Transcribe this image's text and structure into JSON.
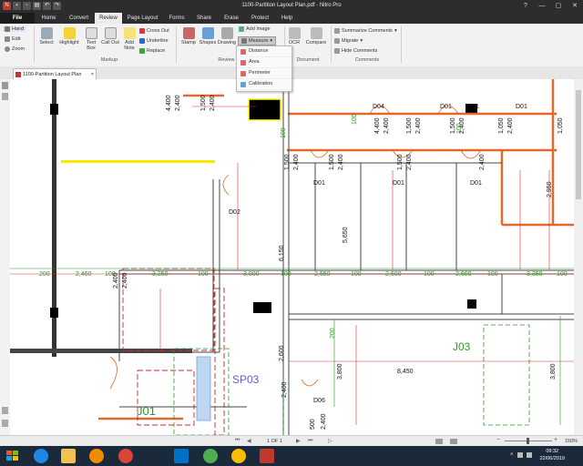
{
  "window": {
    "title": "1100-Partition Layout Plan.pdf - Nitro Pro"
  },
  "tabs": [
    "File",
    "Home",
    "Convert",
    "Review",
    "Page Layout",
    "Forms",
    "Share",
    "Erase",
    "Protect",
    "Help"
  ],
  "ribbon": {
    "hand": "Hand",
    "edit": "Edit",
    "zoom": "Zoom",
    "select": "Select",
    "highlight": "Highlight",
    "textbox": "Text Box",
    "callout": "Call Out",
    "addnote": "Add Note",
    "crossout": "Cross Out",
    "underline": "Underline",
    "replace": "Replace",
    "stamp": "Stamp",
    "shapes": "Shapes",
    "drawing": "Drawing",
    "addimage": "Add Image",
    "measure": "Measure",
    "ocr": "OCR",
    "compare": "Compare",
    "summarize": "Summarize Comments",
    "migrate": "Migrate",
    "hidecomments": "Hide Comments",
    "groups": {
      "markup": "Markup",
      "reviewtools": "Review To",
      "document": "Document",
      "comments": "Comments"
    }
  },
  "measure_menu": [
    "Distance",
    "Area",
    "Perimeter",
    "Calibration"
  ],
  "document_tab": "1100-Partition Layout Plan",
  "drawing": {
    "door_labels": [
      "D04",
      "D01",
      "D01",
      "D01",
      "D01",
      "D01",
      "D01",
      "D02",
      "D06"
    ],
    "room_labels": [
      "J03",
      "J01",
      "SP03"
    ],
    "dims_row": [
      "200",
      "2,460",
      "100",
      "3,250",
      "100",
      "3,000",
      "100",
      "2,650",
      "100",
      "2,600",
      "100",
      "2,600",
      "100",
      "3,350",
      "100"
    ],
    "dims_upper": [
      "4,400",
      "2,400",
      "1,500",
      "2,400",
      "4,400",
      "2,400",
      "1,500",
      "2,400",
      "1,500",
      "2,400",
      "1,050",
      "2,400",
      "1,050",
      "1,600",
      "100",
      "100",
      "100",
      "1,500",
      "2,400",
      "1,500",
      "2,400",
      "1,500",
      "2,400",
      "2,400",
      "2,950",
      "5,650",
      "6,150",
      "2,400",
      "2,400"
    ],
    "dims_lower": [
      "3,800",
      "8,450",
      "3,800",
      "2,400",
      "500",
      "2,400",
      "200",
      "2,600"
    ]
  },
  "status": {
    "page": "1 OF 1",
    "zoom": "150%"
  },
  "clock": {
    "time": "09:32",
    "date": "22/06/2019"
  },
  "colors": {
    "accent": "#d0382b",
    "titlebar": "#2d2d30",
    "taskbar": "#1b2a3a",
    "wall": "#e06a2c",
    "dim_red": "#e03030",
    "dim_green": "#2a9a2a"
  }
}
